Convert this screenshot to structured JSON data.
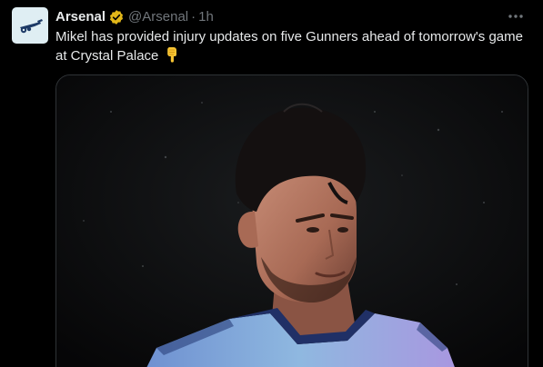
{
  "tweet": {
    "author": {
      "display_name": "Arsenal",
      "handle": "@Arsenal",
      "verified_badge": "verified-badge-icon",
      "avatar": "arsenal-cannon-logo"
    },
    "separator": "·",
    "time": "1h",
    "text": "Mikel has provided injury updates on five Gunners ahead of tomorrow's game at Crystal Palace",
    "emoji": "point-down-emoji",
    "more_menu": "more-options-icon",
    "media": {
      "type": "photo",
      "subject": "player-photo"
    }
  },
  "colors": {
    "background": "#000000",
    "primary_text": "#e7e9ea",
    "secondary_text": "#71767b",
    "verified_gold": "#e2b719",
    "media_border": "#2f3336"
  }
}
